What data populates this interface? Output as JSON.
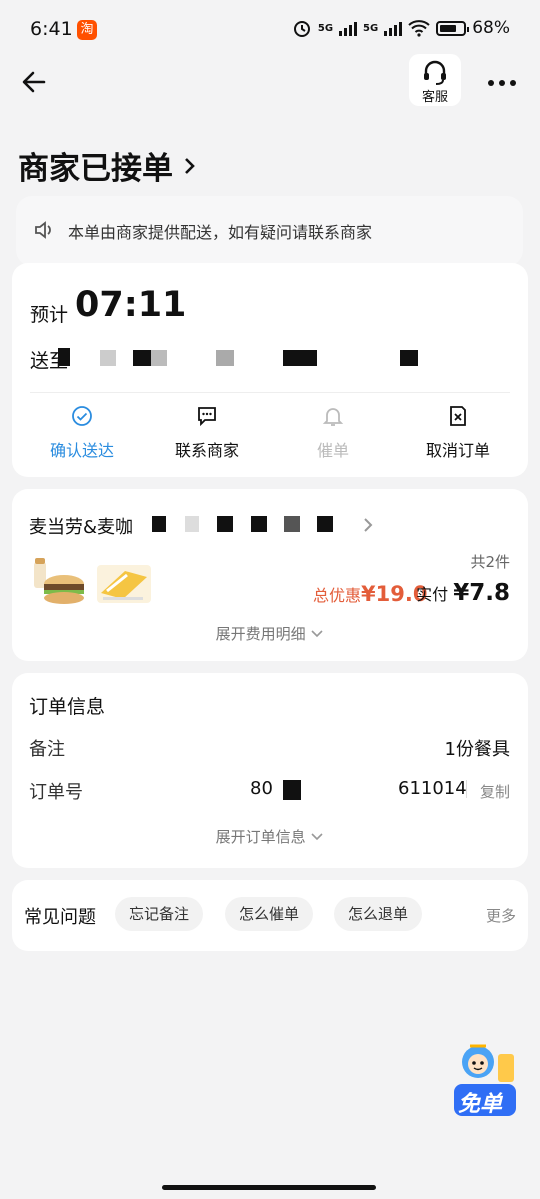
{
  "status_bar": {
    "time": "6:41",
    "battery": "68%",
    "net1": "5G",
    "net2": "5G"
  },
  "header": {
    "kefu_label": "客服"
  },
  "page": {
    "title": "商家已接单"
  },
  "notice": {
    "text": "本单由商家提供配送，如有疑问请联系商家"
  },
  "delivery": {
    "eta_label": "预计",
    "eta_time": "07:11",
    "addr_prefix": "送至",
    "actions": [
      {
        "label": "确认送达",
        "icon": "check-circle-icon",
        "color": "#2a8cdf"
      },
      {
        "label": "联系商家",
        "icon": "chat-icon",
        "color": "#111111"
      },
      {
        "label": "催单",
        "icon": "bell-icon",
        "color": "#bbbbbb"
      },
      {
        "label": "取消订单",
        "icon": "cancel-doc-icon",
        "color": "#111111"
      }
    ]
  },
  "order": {
    "shop_name": "麦当劳&麦咖",
    "count": "共2件",
    "discount_label": "总优惠",
    "discount_value": "¥19.0",
    "paid_label": "实付",
    "paid_value": "¥7.8",
    "expand_fee": "展开费用明细"
  },
  "info": {
    "title": "订单信息",
    "note_label": "备注",
    "note_value": "1份餐具",
    "order_label": "订单号",
    "order_prefix": "80",
    "order_suffix": "611014",
    "copy": "复制",
    "expand": "展开订单信息"
  },
  "faq": {
    "title": "常见问题",
    "chips": [
      "忘记备注",
      "怎么催单",
      "怎么退单"
    ],
    "more": "更多"
  },
  "badge": {
    "text": "免单"
  },
  "colors": {
    "accent": "#2a8cdf",
    "discount": "#e35d3a"
  }
}
